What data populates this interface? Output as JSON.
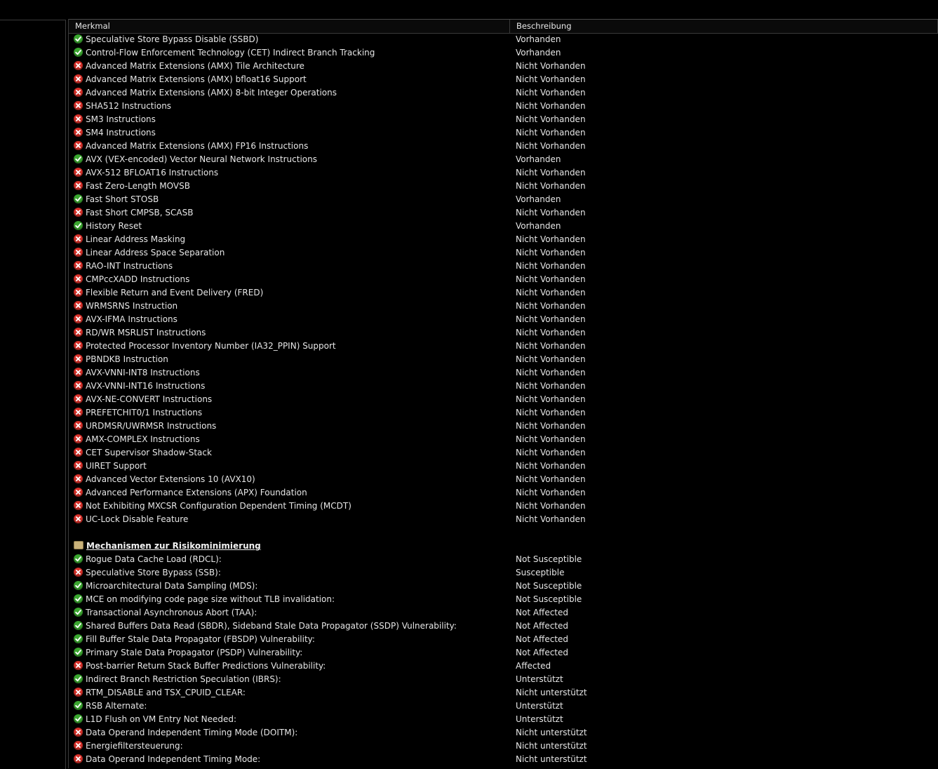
{
  "columns": {
    "feature": "Merkmal",
    "description": "Beschreibung"
  },
  "colors": {
    "ok": "#3aa62f",
    "bad": "#d8312a"
  },
  "features": [
    {
      "icon": "check-icon",
      "name": "Speculative Store Bypass Disable (SSBD)",
      "value": "Vorhanden"
    },
    {
      "icon": "check-icon",
      "name": "Control-Flow Enforcement Technology (CET) Indirect Branch Tracking",
      "value": "Vorhanden"
    },
    {
      "icon": "cross-icon",
      "name": "Advanced Matrix Extensions (AMX) Tile Architecture",
      "value": "Nicht Vorhanden"
    },
    {
      "icon": "cross-icon",
      "name": "Advanced Matrix Extensions (AMX) bfloat16 Support",
      "value": "Nicht Vorhanden"
    },
    {
      "icon": "cross-icon",
      "name": "Advanced Matrix Extensions (AMX) 8-bit Integer Operations",
      "value": "Nicht Vorhanden"
    },
    {
      "icon": "cross-icon",
      "name": "SHA512 Instructions",
      "value": "Nicht Vorhanden"
    },
    {
      "icon": "cross-icon",
      "name": "SM3 Instructions",
      "value": "Nicht Vorhanden"
    },
    {
      "icon": "cross-icon",
      "name": "SM4 Instructions",
      "value": "Nicht Vorhanden"
    },
    {
      "icon": "cross-icon",
      "name": "Advanced Matrix Extensions (AMX) FP16 Instructions",
      "value": "Nicht Vorhanden"
    },
    {
      "icon": "check-icon",
      "name": "AVX (VEX-encoded) Vector Neural Network Instructions",
      "value": "Vorhanden"
    },
    {
      "icon": "cross-icon",
      "name": "AVX-512 BFLOAT16 Instructions",
      "value": "Nicht Vorhanden"
    },
    {
      "icon": "cross-icon",
      "name": "Fast Zero-Length MOVSB",
      "value": "Nicht Vorhanden"
    },
    {
      "icon": "check-icon",
      "name": "Fast Short STOSB",
      "value": "Vorhanden"
    },
    {
      "icon": "cross-icon",
      "name": "Fast Short CMPSB, SCASB",
      "value": "Nicht Vorhanden"
    },
    {
      "icon": "check-icon",
      "name": "History Reset",
      "value": "Vorhanden"
    },
    {
      "icon": "cross-icon",
      "name": "Linear Address Masking",
      "value": "Nicht Vorhanden"
    },
    {
      "icon": "cross-icon",
      "name": "Linear Address Space Separation",
      "value": "Nicht Vorhanden"
    },
    {
      "icon": "cross-icon",
      "name": "RAO-INT Instructions",
      "value": "Nicht Vorhanden"
    },
    {
      "icon": "cross-icon",
      "name": "CMPccXADD Instructions",
      "value": "Nicht Vorhanden"
    },
    {
      "icon": "cross-icon",
      "name": "Flexible Return and Event Delivery (FRED)",
      "value": "Nicht Vorhanden"
    },
    {
      "icon": "cross-icon",
      "name": "WRMSRNS Instruction",
      "value": "Nicht Vorhanden"
    },
    {
      "icon": "cross-icon",
      "name": "AVX-IFMA Instructions",
      "value": "Nicht Vorhanden"
    },
    {
      "icon": "cross-icon",
      "name": "RD/WR MSRLIST Instructions",
      "value": "Nicht Vorhanden"
    },
    {
      "icon": "cross-icon",
      "name": "Protected Processor Inventory Number (IA32_PPIN) Support",
      "value": "Nicht Vorhanden"
    },
    {
      "icon": "cross-icon",
      "name": "PBNDKB Instruction",
      "value": "Nicht Vorhanden"
    },
    {
      "icon": "cross-icon",
      "name": "AVX-VNNI-INT8 Instructions",
      "value": "Nicht Vorhanden"
    },
    {
      "icon": "cross-icon",
      "name": "AVX-VNNI-INT16 Instructions",
      "value": "Nicht Vorhanden"
    },
    {
      "icon": "cross-icon",
      "name": "AVX-NE-CONVERT Instructions",
      "value": "Nicht Vorhanden"
    },
    {
      "icon": "cross-icon",
      "name": "PREFETCHIT0/1 Instructions",
      "value": "Nicht Vorhanden"
    },
    {
      "icon": "cross-icon",
      "name": "URDMSR/UWRMSR Instructions",
      "value": "Nicht Vorhanden"
    },
    {
      "icon": "cross-icon",
      "name": "AMX-COMPLEX Instructions",
      "value": "Nicht Vorhanden"
    },
    {
      "icon": "cross-icon",
      "name": "CET Supervisor Shadow-Stack",
      "value": "Nicht Vorhanden"
    },
    {
      "icon": "cross-icon",
      "name": "UIRET Support",
      "value": "Nicht Vorhanden"
    },
    {
      "icon": "cross-icon",
      "name": "Advanced Vector Extensions 10 (AVX10)",
      "value": "Nicht Vorhanden"
    },
    {
      "icon": "cross-icon",
      "name": "Advanced Performance Extensions (APX) Foundation",
      "value": "Nicht Vorhanden"
    },
    {
      "icon": "cross-icon",
      "name": "Not Exhibiting MXCSR Configuration Dependent Timing (MCDT)",
      "value": "Nicht Vorhanden"
    },
    {
      "icon": "cross-icon",
      "name": "UC-Lock Disable Feature",
      "value": "Nicht Vorhanden"
    }
  ],
  "mitigation_section": {
    "title": "Mechanismen zur Risikominimierung",
    "icon": "section-icon",
    "items": [
      {
        "icon": "check-icon",
        "name": "Rogue Data Cache Load (RDCL):",
        "value": "Not Susceptible"
      },
      {
        "icon": "cross-icon",
        "name": "Speculative Store Bypass (SSB):",
        "value": "Susceptible"
      },
      {
        "icon": "check-icon",
        "name": "Microarchitectural Data Sampling (MDS):",
        "value": "Not Susceptible"
      },
      {
        "icon": "check-icon",
        "name": "MCE on modifying code page size without TLB invalidation:",
        "value": "Not Susceptible"
      },
      {
        "icon": "check-icon",
        "name": "Transactional Asynchronous Abort (TAA):",
        "value": "Not Affected"
      },
      {
        "icon": "check-icon",
        "name": "Shared Buffers Data Read (SBDR), Sideband Stale Data Propagator (SSDP) Vulnerability:",
        "value": "Not Affected"
      },
      {
        "icon": "check-icon",
        "name": "Fill Buffer Stale Data Propagator (FBSDP) Vulnerability:",
        "value": "Not Affected"
      },
      {
        "icon": "check-icon",
        "name": "Primary Stale Data Propagator (PSDP) Vulnerability:",
        "value": "Not Affected"
      },
      {
        "icon": "cross-icon",
        "name": "Post-barrier Return Stack Buffer Predictions Vulnerability:",
        "value": "Affected"
      },
      {
        "icon": "check-icon",
        "name": "Indirect Branch Restriction Speculation (IBRS):",
        "value": "Unterstützt"
      },
      {
        "icon": "cross-icon",
        "name": "RTM_DISABLE and TSX_CPUID_CLEAR:",
        "value": "Nicht unterstützt"
      },
      {
        "icon": "check-icon",
        "name": "RSB Alternate:",
        "value": "Unterstützt"
      },
      {
        "icon": "check-icon",
        "name": "L1D Flush on VM Entry Not Needed:",
        "value": "Unterstützt"
      },
      {
        "icon": "cross-icon",
        "name": "Data Operand Independent Timing Mode (DOITM):",
        "value": "Nicht unterstützt"
      },
      {
        "icon": "cross-icon",
        "name": "Energiefiltersteuerung:",
        "value": "Nicht unterstützt"
      },
      {
        "icon": "cross-icon",
        "name": "Data Operand Independent Timing Mode:",
        "value": "Nicht unterstützt"
      }
    ]
  }
}
